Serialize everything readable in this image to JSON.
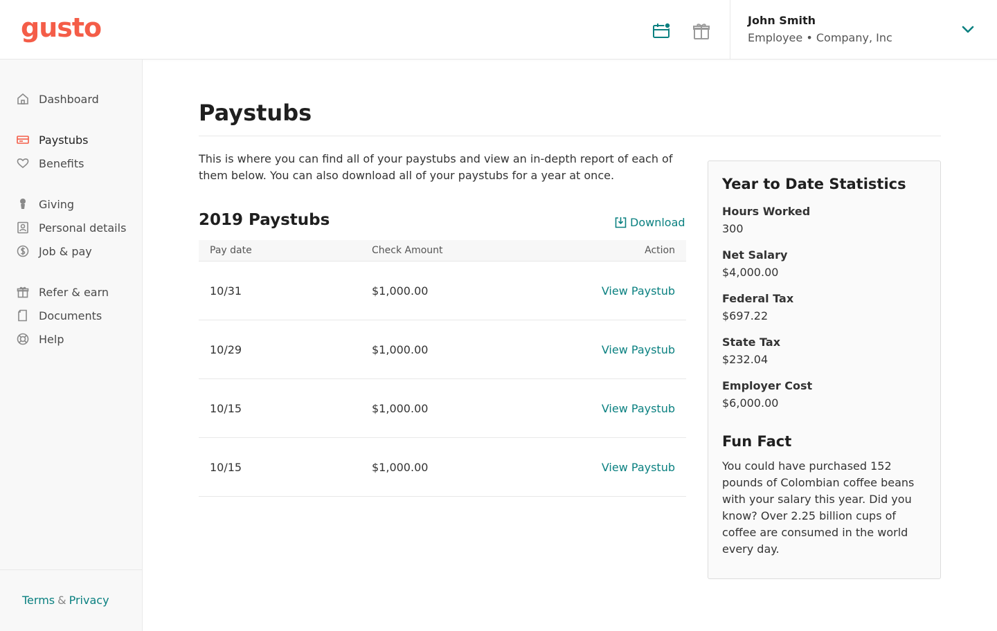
{
  "brand": {
    "logo": "gusto",
    "accent_color": "#f45d48",
    "link_color": "#0a8080"
  },
  "header": {
    "icons": [
      "calendar-notification-icon",
      "gift-icon"
    ],
    "user": {
      "name": "John Smith",
      "role": "Employee • Company, Inc"
    }
  },
  "sidebar": {
    "items": [
      {
        "label": "Dashboard",
        "icon": "home-icon",
        "active": false
      },
      {
        "label": "Paystubs",
        "icon": "paystub-icon",
        "active": true
      },
      {
        "label": "Benefits",
        "icon": "heart-icon",
        "active": false
      },
      {
        "label": "Giving",
        "icon": "giving-icon",
        "active": false
      },
      {
        "label": "Personal details",
        "icon": "id-card-icon",
        "active": false
      },
      {
        "label": "Job & pay",
        "icon": "dollar-icon",
        "active": false
      },
      {
        "label": "Refer & earn",
        "icon": "gift-icon",
        "active": false
      },
      {
        "label": "Documents",
        "icon": "document-icon",
        "active": false
      },
      {
        "label": "Help",
        "icon": "lifebuoy-icon",
        "active": false
      }
    ],
    "footer": {
      "terms": "Terms",
      "amp": "&",
      "privacy": "Privacy"
    }
  },
  "main": {
    "title": "Paystubs",
    "intro": "This is where you can find all of your paystubs and view an in-depth report of each of them below. You can also download all of your paystubs for a year at once.",
    "section_title": "2019 Paystubs",
    "download_label": "Download",
    "table": {
      "headers": [
        "Pay date",
        "Check Amount",
        "Action"
      ],
      "rows": [
        {
          "date": "10/31",
          "amount": "$1,000.00",
          "action": "View Paystub"
        },
        {
          "date": "10/29",
          "amount": "$1,000.00",
          "action": "View Paystub"
        },
        {
          "date": "10/15",
          "amount": "$1,000.00",
          "action": "View Paystub"
        },
        {
          "date": "10/15",
          "amount": "$1,000.00",
          "action": "View Paystub"
        }
      ]
    }
  },
  "ytd": {
    "title": "Year to Date Statistics",
    "stats": [
      {
        "label": "Hours Worked",
        "value": "300"
      },
      {
        "label": "Net Salary",
        "value": "$4,000.00"
      },
      {
        "label": "Federal Tax",
        "value": "$697.22"
      },
      {
        "label": "State Tax",
        "value": "$232.04"
      },
      {
        "label": "Employer Cost",
        "value": "$6,000.00"
      }
    ],
    "fun_fact_title": "Fun Fact",
    "fun_fact": "You could have purchased 152 pounds of Colombian coffee beans with your salary this year. Did you know? Over 2.25 billion cups of coffee are consumed in the world every day."
  }
}
